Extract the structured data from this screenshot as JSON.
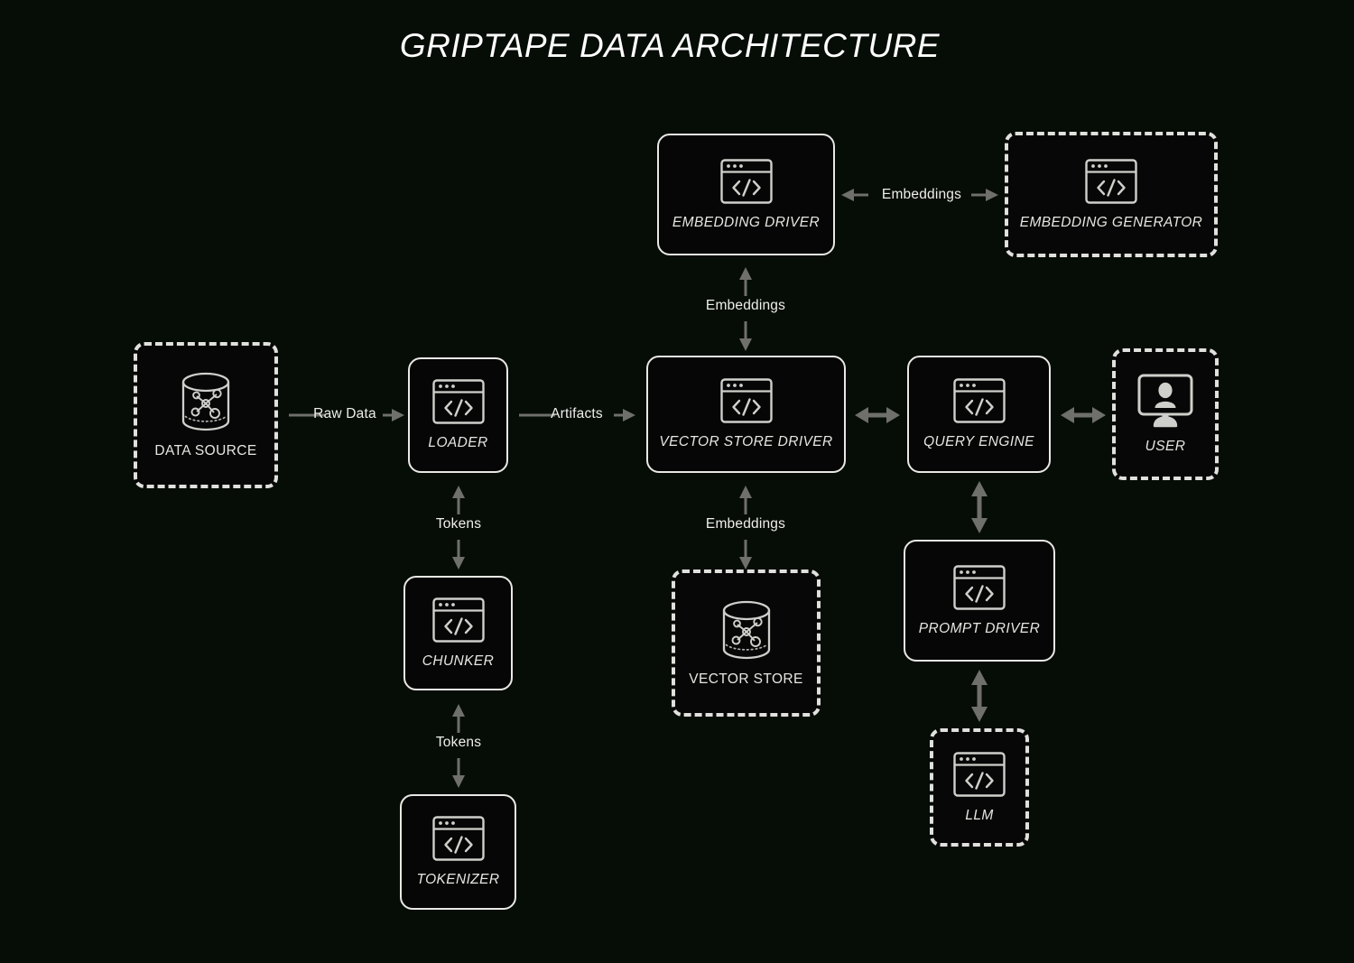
{
  "title": "GRIPTAPE DATA ARCHITECTURE",
  "colors": {
    "background": "#060c06",
    "node_border": "#e8e8e4",
    "icon": "#cfcfcb",
    "arrow": "#6f6f6c",
    "text": "#efefec"
  },
  "nodes": [
    {
      "id": "data-source",
      "label": "DATA SOURCE",
      "style": "dashed",
      "icon": "database-graph-icon",
      "italic": false
    },
    {
      "id": "loader",
      "label": "LOADER",
      "style": "solid",
      "icon": "code-window-icon",
      "italic": true
    },
    {
      "id": "chunker",
      "label": "CHUNKER",
      "style": "solid",
      "icon": "code-window-icon",
      "italic": true
    },
    {
      "id": "tokenizer",
      "label": "TOKENIZER",
      "style": "solid",
      "icon": "code-window-icon",
      "italic": true
    },
    {
      "id": "embedding-driver",
      "label": "EMBEDDING DRIVER",
      "style": "solid",
      "icon": "code-window-icon",
      "italic": true
    },
    {
      "id": "embedding-generator",
      "label": "EMBEDDING GENERATOR",
      "style": "dashed",
      "icon": "code-window-icon",
      "italic": true
    },
    {
      "id": "vector-store-driver",
      "label": "VECTOR STORE DRIVER",
      "style": "solid",
      "icon": "code-window-icon",
      "italic": true
    },
    {
      "id": "vector-store",
      "label": "VECTOR STORE",
      "style": "dashed",
      "icon": "database-graph-icon",
      "italic": false
    },
    {
      "id": "query-engine",
      "label": "QUERY ENGINE",
      "style": "solid",
      "icon": "code-window-icon",
      "italic": true
    },
    {
      "id": "prompt-driver",
      "label": "PROMPT DRIVER",
      "style": "solid",
      "icon": "code-window-icon",
      "italic": true
    },
    {
      "id": "llm",
      "label": "LLM",
      "style": "dashed",
      "icon": "code-window-icon",
      "italic": true
    },
    {
      "id": "user",
      "label": "USER",
      "style": "dashed",
      "icon": "monitor-user-icon",
      "italic": true
    }
  ],
  "edges": [
    {
      "id": "data-source-to-loader",
      "label": "Raw Data",
      "direction": "right"
    },
    {
      "id": "loader-to-vector-store-driver",
      "label": "Artifacts",
      "direction": "right"
    },
    {
      "id": "embedding-driver-to-embedding-generator",
      "label": "Embeddings",
      "direction": "both-horizontal"
    },
    {
      "id": "vector-store-driver-to-embedding-driver",
      "label": "Embeddings",
      "direction": "both-vertical"
    },
    {
      "id": "loader-to-chunker",
      "label": "Tokens",
      "direction": "both-vertical"
    },
    {
      "id": "chunker-to-tokenizer",
      "label": "Tokens",
      "direction": "both-vertical"
    },
    {
      "id": "vector-store-driver-to-vector-store",
      "label": "Embeddings",
      "direction": "both-vertical"
    },
    {
      "id": "vector-store-driver-to-query-engine",
      "label": "",
      "direction": "both-horizontal"
    },
    {
      "id": "query-engine-to-user",
      "label": "",
      "direction": "both-horizontal"
    },
    {
      "id": "query-engine-to-prompt-driver",
      "label": "",
      "direction": "both-vertical"
    },
    {
      "id": "prompt-driver-to-llm",
      "label": "",
      "direction": "both-vertical"
    }
  ]
}
